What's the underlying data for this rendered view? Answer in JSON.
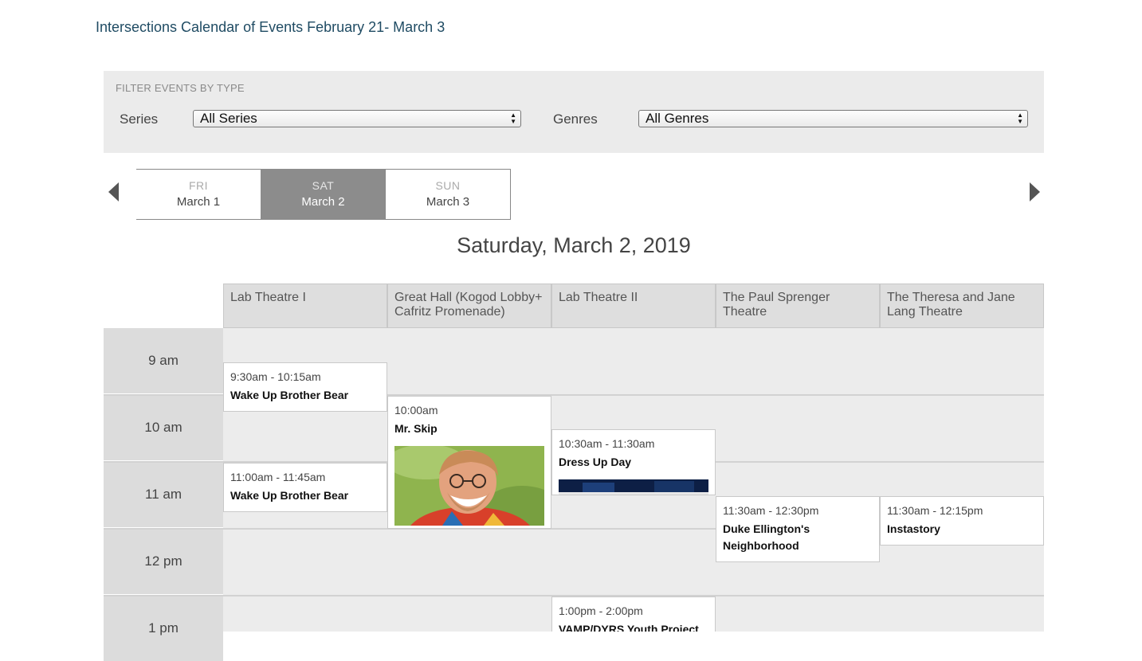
{
  "page": {
    "title": "Intersections Calendar of Events February 21- March 3"
  },
  "filters": {
    "heading": "FILTER EVENTS BY TYPE",
    "series_label": "Series",
    "series_value": "All Series",
    "genres_label": "Genres",
    "genres_value": "All Genres"
  },
  "day_nav": {
    "prev_icon": "caret-left-icon",
    "next_icon": "caret-right-icon",
    "days": [
      {
        "dow": "FRI",
        "date": "March 1",
        "active": false
      },
      {
        "dow": "SAT",
        "date": "March 2",
        "active": true
      },
      {
        "dow": "SUN",
        "date": "March 3",
        "active": false
      }
    ]
  },
  "day_heading": "Saturday, March 2, 2019",
  "venues": [
    "Lab Theatre I",
    "Great Hall (Kogod Lobby+ Cafritz Promenade)",
    "Lab Theatre II",
    "The Paul Sprenger Theatre",
    "The Theresa and Jane Lang Theatre"
  ],
  "times": [
    "9 am",
    "10 am",
    "11 am",
    "12 pm",
    "1 pm"
  ],
  "events": [
    {
      "time": "9:30am - 10:15am",
      "title": "Wake Up Brother Bear",
      "venue": "Lab Theatre I"
    },
    {
      "time": "11:00am - 11:45am",
      "title": "Wake Up Brother Bear",
      "venue": "Lab Theatre I"
    },
    {
      "time": "10:00am",
      "title": "Mr. Skip",
      "venue": "Great Hall (Kogod Lobby+ Cafritz Promenade)",
      "image": "performer-photo"
    },
    {
      "time": "10:30am - 11:30am",
      "title": "Dress Up Day",
      "venue": "Lab Theatre II",
      "image": "event-photo"
    },
    {
      "time": "11:30am - 12:30pm",
      "title": "Duke Ellington's Neighborhood",
      "venue": "The Paul Sprenger Theatre"
    },
    {
      "time": "11:30am - 12:15pm",
      "title": "Instastory",
      "venue": "The Theresa and Jane Lang Theatre"
    },
    {
      "time": "1:00pm - 2:00pm",
      "title": "VAMP/DYRS Youth Project",
      "venue": "Lab Theatre II"
    }
  ],
  "colors": {
    "title_link": "#1f4b63",
    "active_tab": "#8c8c8c",
    "grid_background": "#ececec",
    "time_column": "#dcdcdc"
  }
}
